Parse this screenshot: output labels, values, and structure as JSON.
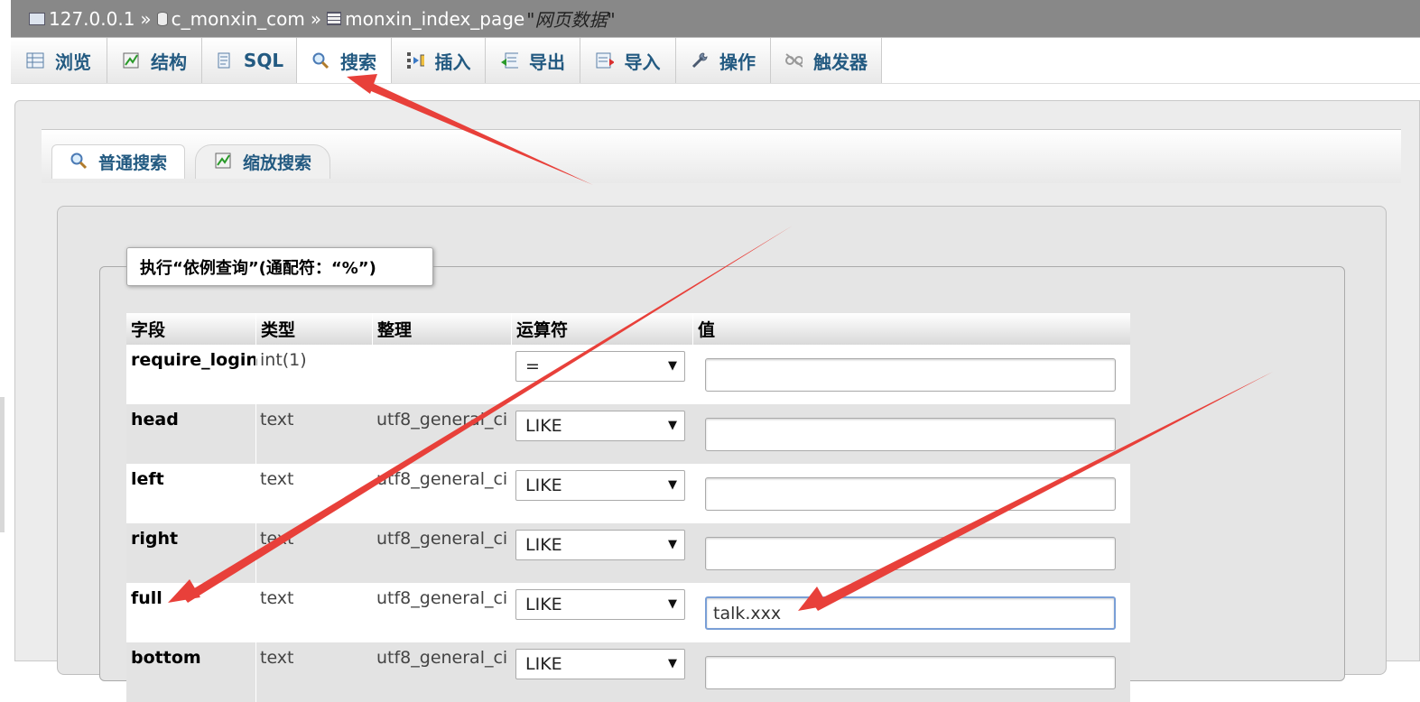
{
  "breadcrumb": {
    "server": "127.0.0.1",
    "separator": "»",
    "database": "c_monxin_com",
    "table": "monxin_index_page",
    "table_comment": "\"网页数据\""
  },
  "tabs": [
    {
      "label": "浏览",
      "icon": "browse-icon"
    },
    {
      "label": "结构",
      "icon": "structure-icon"
    },
    {
      "label": "SQL",
      "icon": "sql-icon"
    },
    {
      "label": "搜索",
      "icon": "search-icon",
      "active": true
    },
    {
      "label": "插入",
      "icon": "insert-icon"
    },
    {
      "label": "导出",
      "icon": "export-icon"
    },
    {
      "label": "导入",
      "icon": "import-icon"
    },
    {
      "label": "操作",
      "icon": "wrench-icon"
    },
    {
      "label": "触发器",
      "icon": "trigger-icon"
    }
  ],
  "subtabs": [
    {
      "label": "普通搜索",
      "icon": "search-icon",
      "active": true
    },
    {
      "label": "缩放搜索",
      "icon": "zoom-chart-icon"
    }
  ],
  "search_form": {
    "legend": "执行“依例查询”(通配符：“%”)",
    "columns": {
      "field": "字段",
      "type": "类型",
      "collation": "整理",
      "operator": "运算符",
      "value": "值"
    },
    "rows": [
      {
        "field": "require_login",
        "type": "int(1)",
        "collation": "",
        "operator": "=",
        "value": ""
      },
      {
        "field": "head",
        "type": "text",
        "collation": "utf8_general_ci",
        "operator": "LIKE",
        "value": ""
      },
      {
        "field": "left",
        "type": "text",
        "collation": "utf8_general_ci",
        "operator": "LIKE",
        "value": ""
      },
      {
        "field": "right",
        "type": "text",
        "collation": "utf8_general_ci",
        "operator": "LIKE",
        "value": ""
      },
      {
        "field": "full",
        "type": "text",
        "collation": "utf8_general_ci",
        "operator": "LIKE",
        "value": "talk.xxx"
      },
      {
        "field": "bottom",
        "type": "text",
        "collation": "utf8_general_ci",
        "operator": "LIKE",
        "value": ""
      }
    ]
  },
  "colors": {
    "link_blue": "#235a81",
    "annotation_red": "#e8403a",
    "breadcrumb_bg": "#888888"
  }
}
